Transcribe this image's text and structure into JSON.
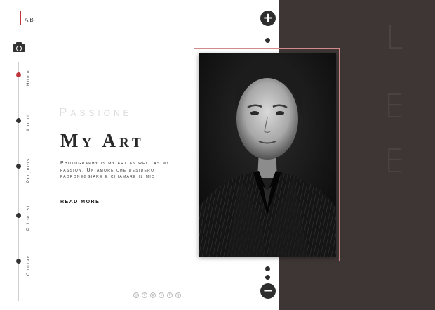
{
  "brand": {
    "logo_text": "AB"
  },
  "nav": {
    "items": [
      {
        "label": "Home",
        "active": true
      },
      {
        "label": "About",
        "active": false
      },
      {
        "label": "Projects",
        "active": false
      },
      {
        "label": "Pricelist",
        "active": false
      },
      {
        "label": "Contact",
        "active": false
      }
    ]
  },
  "hero": {
    "subtitle": "Passione",
    "title": "My Art",
    "text": "Photography is my art as well as my passion. Un amore che desidero padroneggiare e chiamare il mio",
    "cta": "read more"
  },
  "side_word": {
    "letters": [
      "L",
      "E",
      "E"
    ]
  },
  "slider": {
    "next_symbol": "+",
    "prev_symbol": "−"
  },
  "social": {
    "icons": [
      "instagram-icon",
      "facebook-icon",
      "pinterest-icon",
      "twitter-icon",
      "tumblr-icon",
      "google-plus-icon"
    ],
    "glyphs": [
      "◎",
      "f",
      "p",
      "t",
      "t",
      "g"
    ]
  },
  "colors": {
    "accent": "#c0343c",
    "dark_panel": "#3d3634"
  }
}
